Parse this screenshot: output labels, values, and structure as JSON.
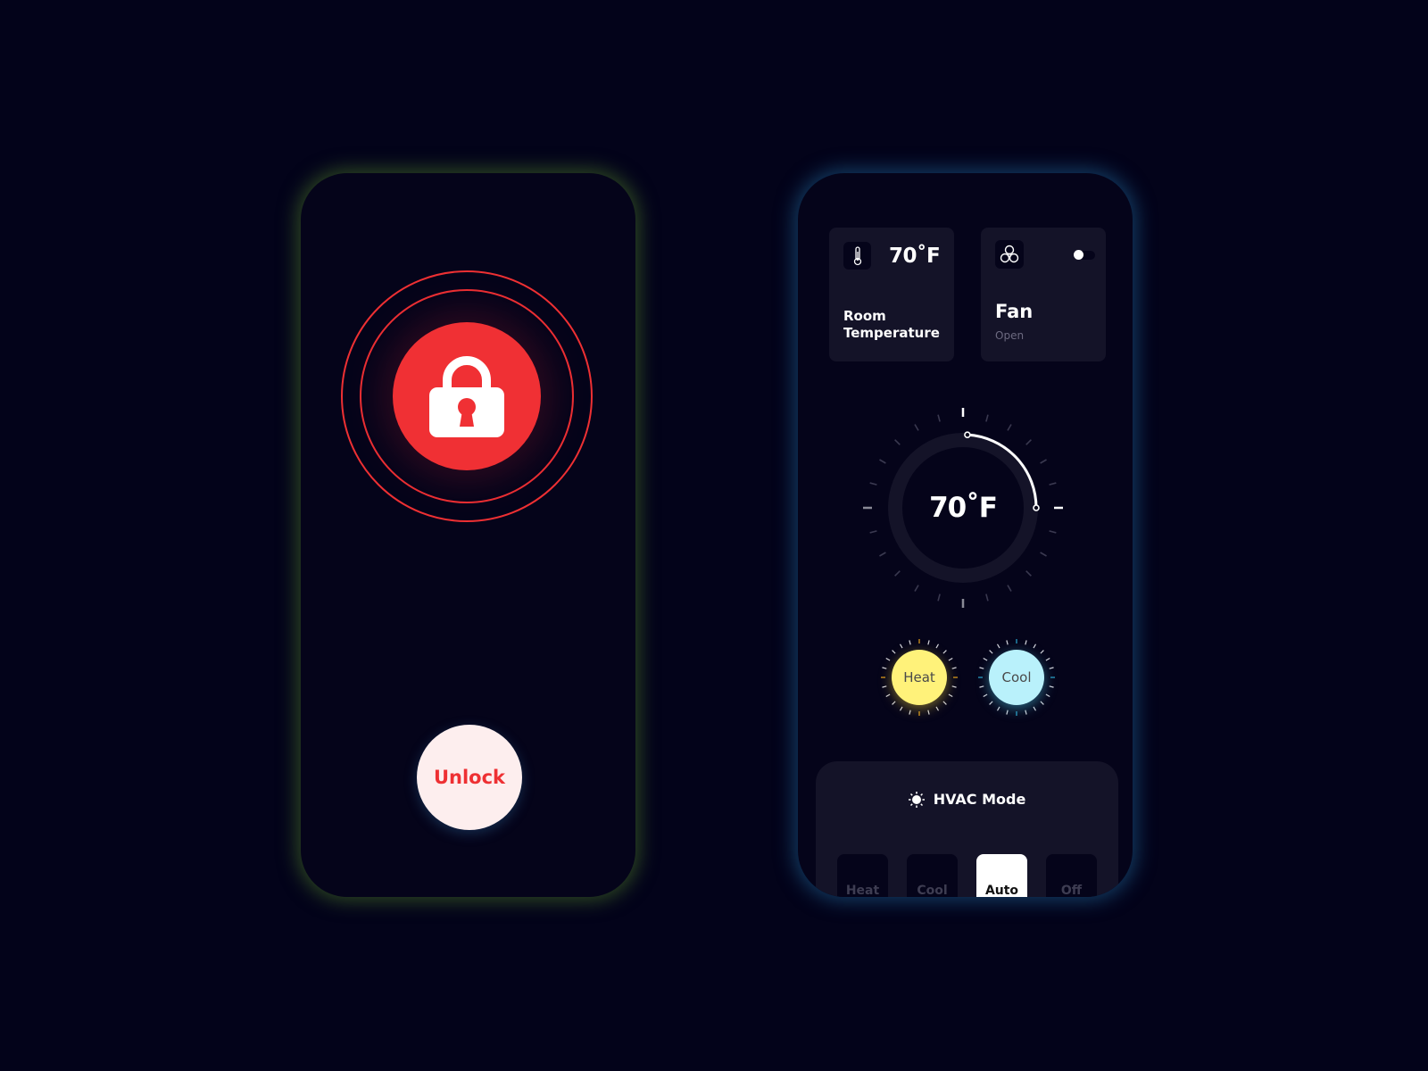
{
  "lock_screen": {
    "lock_state": "locked",
    "unlock_button": "Unlock",
    "accent_color": "#f03034"
  },
  "hvac_screen": {
    "room_card": {
      "value": "70˚F",
      "label": "Room Temperature"
    },
    "fan_card": {
      "title": "Fan",
      "status": "Open",
      "toggle_on": true
    },
    "dial": {
      "value": "70˚F",
      "setpoint_fraction": 0.25
    },
    "quick_modes": [
      {
        "label": "Heat",
        "color": "#fff27a",
        "accent": "#e7a21c"
      },
      {
        "label": "Cool",
        "color": "#b9f1fb",
        "accent": "#2aa6d0"
      }
    ],
    "hvac_mode": {
      "title": "HVAC Mode",
      "options": [
        "Heat",
        "Cool",
        "Auto",
        "Off"
      ],
      "selected": "Auto"
    }
  }
}
